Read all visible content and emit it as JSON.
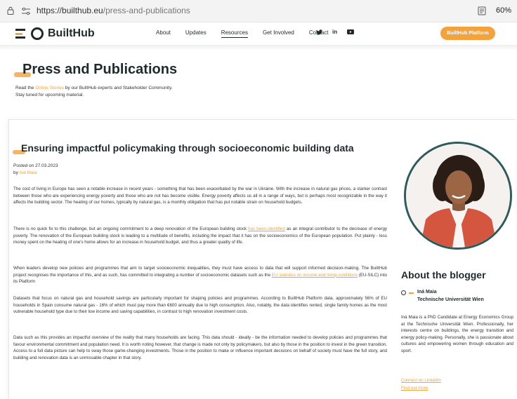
{
  "browser": {
    "url_domain": "https://builthub.eu",
    "url_path": "/press-and-publications",
    "zoom": "60%"
  },
  "nav": {
    "brand": "BuiltHub",
    "links": [
      "About",
      "Updates",
      "Resources",
      "Get Involved",
      "Contact"
    ],
    "active": "Resources",
    "social": [
      "twitter-icon",
      "linkedin-icon",
      "youtube-icon"
    ],
    "social_glyphs": [
      "🐦",
      "in",
      "▶"
    ],
    "platform_button": "BuiltHub Platform"
  },
  "press": {
    "title": "Press and Publications",
    "intro_before": "Read the ",
    "intro_link": "Online Stories",
    "intro_after": " by our BuiltHub experts and Stakeholder Community.",
    "intro_line2": "Stay tuned for upcoming material."
  },
  "article": {
    "title": "Ensuring impactful policymaking through socioeconomic building data",
    "posted": "Posted on 27.03.2023",
    "by": "by ",
    "author": "Iná Maia",
    "p1": "The cost of living in Europe has seen a notable increase in recent years - something that has been exacerbated by the war in Ukraine. With the increase in natural gas prices, a starker contrast between those who are experiencing energy poverty and those who are not has become visible. Energy poverty affects us all in a range of ways, but is perhaps most recognizable in the way it affects the building sector. The heating of our homes, typically by natural gas, is a monthly obligation that has put notable strain on household budgets.",
    "p2_before": "There is no quick fix to this challenge, but an ongoing commitment to a deep renovation of the European building stock ",
    "p2_link": "has been identified",
    "p2_after": " as an integral contributor to the decrease of energy poverty. The renovation of the European building stock is leading to a multitude of benefits, including the impact that it has on the socioeconomics of the European population. Put plainly - less money spent on the heating of one's home allows for an increase in household budget, and thus a greater quality of life.",
    "p3_before": "When leaders develop new policies and programmes that aim to target socioeconomic inequalities, they must have access to data that will support informed decision-making. The BuiltHub project recognises the importance of this, and as such, has committed to integrating a number of socioeconomic datasets such as the ",
    "p3_link": "EU statistics on income and living conditions",
    "p3_after": " (EU-SILC) into its Platform",
    "p4": "Datasets that focus on natural gas and household savings are particularly important for shaping policies and programmes. According to BuiltHub Platform data, approximately 56% of EU households in Spain consume natural gas - 16% of which must pay more than €600 annually due to high consumption. Also, notably, the data identifies rented, single family homes as the most vulnerable household type due to their low income and saving capabilities, in contrast to high renovation investment costs.",
    "p5": "Data such as this provides an impactful overview of the reality that many households are facing. This data should - ideally - be the information needed to develop policies and programmes that favour environmental commitment and population need. It is worth noting however, that change is made not only by policymakers, but also by those in the position to invest in the green transition. Access to a full data picture can help to sway those game-changing investments. Those in the position to make or influence important decisions on behalf of society must have the full story, and building and renovation data is an unmissable chapter in that story."
  },
  "blogger": {
    "heading": "About the blogger",
    "name": "Iná Maia",
    "affiliation": "Technische Universität Wien",
    "bio": "Iná Maia is a PhD Candidate at Energy Economics Group at the Technische Universität Wien. Professionally, her interests centre on buildings, the energy transition and energy policy-making. Personally, she is passionate about cultures and empowering women through education and sport.",
    "linkedin": "Connect on LinkedIn",
    "more": "Find out more"
  },
  "colors": {
    "accent": "#f4a23c",
    "dark": "#1f2a2a",
    "ring": "#2e5a5a"
  }
}
